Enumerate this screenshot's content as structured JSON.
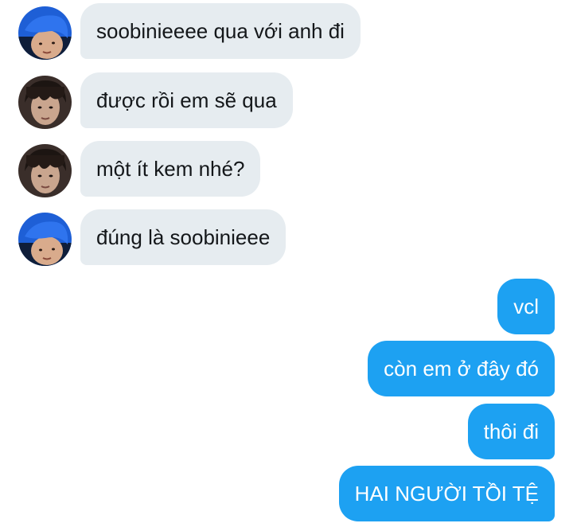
{
  "colors": {
    "received_bubble": "#e6ecf0",
    "received_text": "#14171a",
    "sent_bubble": "#1da1f2",
    "sent_text": "#ffffff"
  },
  "messages": [
    {
      "direction": "received",
      "avatar": "avatar-blue-hair",
      "text": "soobinieeee qua với anh đi"
    },
    {
      "direction": "received",
      "avatar": "avatar-dark-hair",
      "text": "được rồi em sẽ qua"
    },
    {
      "direction": "received",
      "avatar": "avatar-dark-hair",
      "text": "một ít kem nhé?"
    },
    {
      "direction": "received",
      "avatar": "avatar-blue-hair",
      "text": "đúng là soobinieee"
    },
    {
      "direction": "sent",
      "text": "vcl"
    },
    {
      "direction": "sent",
      "text": "còn em ở đây đó"
    },
    {
      "direction": "sent",
      "text": "thôi đi"
    },
    {
      "direction": "sent",
      "text": "HAI NGƯỜI TỒI TỆ"
    }
  ]
}
